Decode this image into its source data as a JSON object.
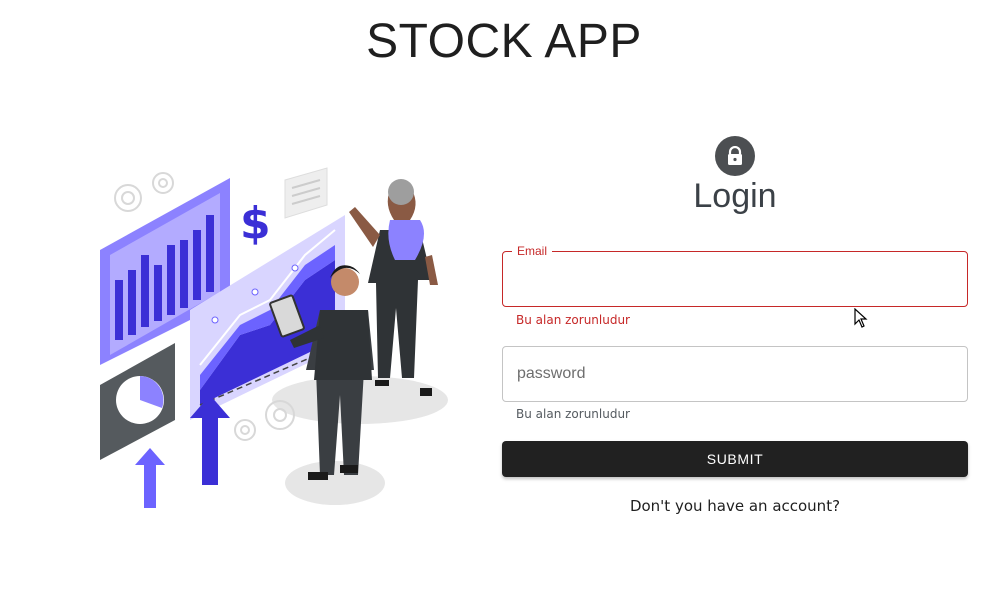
{
  "header": {
    "title": "STOCK APP"
  },
  "login": {
    "heading": "Login",
    "lock_icon": "lock-icon",
    "email": {
      "label": "Email",
      "value": "",
      "error": "Bu alan zorunludur"
    },
    "password": {
      "placeholder": "password",
      "value": "",
      "helper": "Bu alan zorunludur"
    },
    "submit_label": "SUBMIT",
    "register_link": "Don't you have an account?"
  },
  "illustration": {
    "icon": "stock-analytics-illustration"
  },
  "colors": {
    "accent_purple": "#6c63ff",
    "error_red": "#c62828",
    "button_dark": "#212121",
    "avatar_gray": "#4c4f52"
  }
}
